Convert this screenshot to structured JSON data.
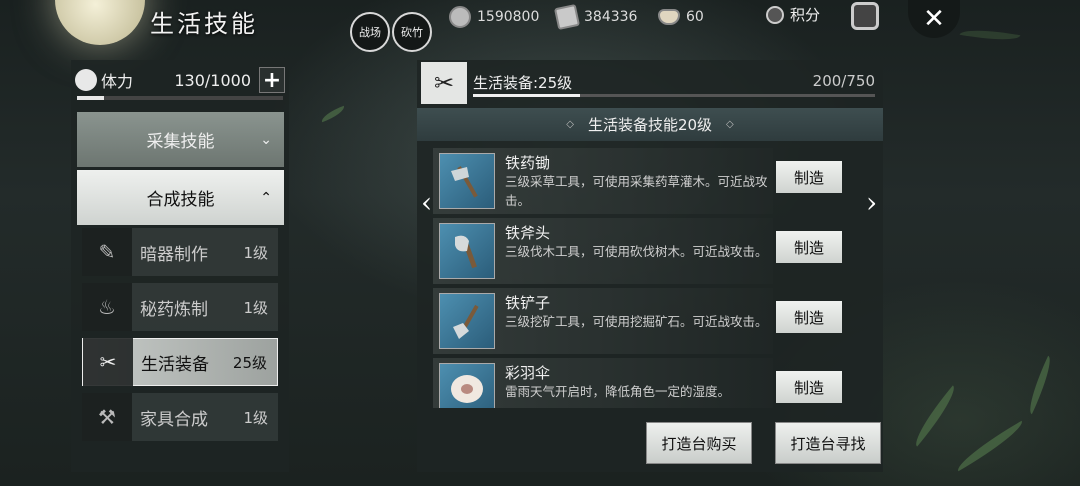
{
  "header": {
    "title": "生活技能",
    "circle_buttons": [
      "战场",
      "砍竹"
    ],
    "currencies": [
      {
        "icon": "coin-icon",
        "value": "1590800"
      },
      {
        "icon": "scroll-icon",
        "value": "384336"
      },
      {
        "icon": "ingot-icon",
        "value": "60"
      }
    ],
    "points_label": "积分",
    "close_symbol": "✕"
  },
  "stamina": {
    "label": "体力",
    "value": "130/1000",
    "plus": "+",
    "fraction": 0.13
  },
  "categories": {
    "gather": {
      "label": "采集技能",
      "arrow": "⌄"
    },
    "craft": {
      "label": "合成技能",
      "arrow": "⌃"
    }
  },
  "skills": [
    {
      "name": "暗器制作",
      "level": "1级",
      "icon": "dart-icon",
      "glyph": "✎"
    },
    {
      "name": "秘药炼制",
      "level": "1级",
      "icon": "medicine-icon",
      "glyph": "♨"
    },
    {
      "name": "生活装备",
      "level": "25级",
      "icon": "scissors-icon",
      "glyph": "✂",
      "active": true
    },
    {
      "name": "家具合成",
      "level": "1级",
      "icon": "anvil-icon",
      "glyph": "⚒"
    }
  ],
  "detail": {
    "title": "生活装备:25级",
    "progress": "200/750",
    "progress_fraction": 0.267,
    "tier_label": "生活装备技能20级",
    "diamond": "◇",
    "items": [
      {
        "name": "铁药锄",
        "desc": "三级采草工具，可使用采集药草灌木。可近战攻击。",
        "button": "制造",
        "icon": "hoe-icon"
      },
      {
        "name": "铁斧头",
        "desc": "三级伐木工具，可使用砍伐树木。可近战攻击。",
        "button": "制造",
        "icon": "axe-icon"
      },
      {
        "name": "铁铲子",
        "desc": "三级挖矿工具，可使用挖掘矿石。可近战攻击。",
        "button": "制造",
        "icon": "shovel-icon"
      },
      {
        "name": "彩羽伞",
        "desc": "雷雨天气开启时，降低角色一定的湿度。",
        "button": "制造",
        "icon": "umbrella-icon"
      }
    ],
    "buy_button": "打造台购买",
    "find_button": "打造台寻找",
    "arrow_left": "‹",
    "arrow_right": "›"
  }
}
